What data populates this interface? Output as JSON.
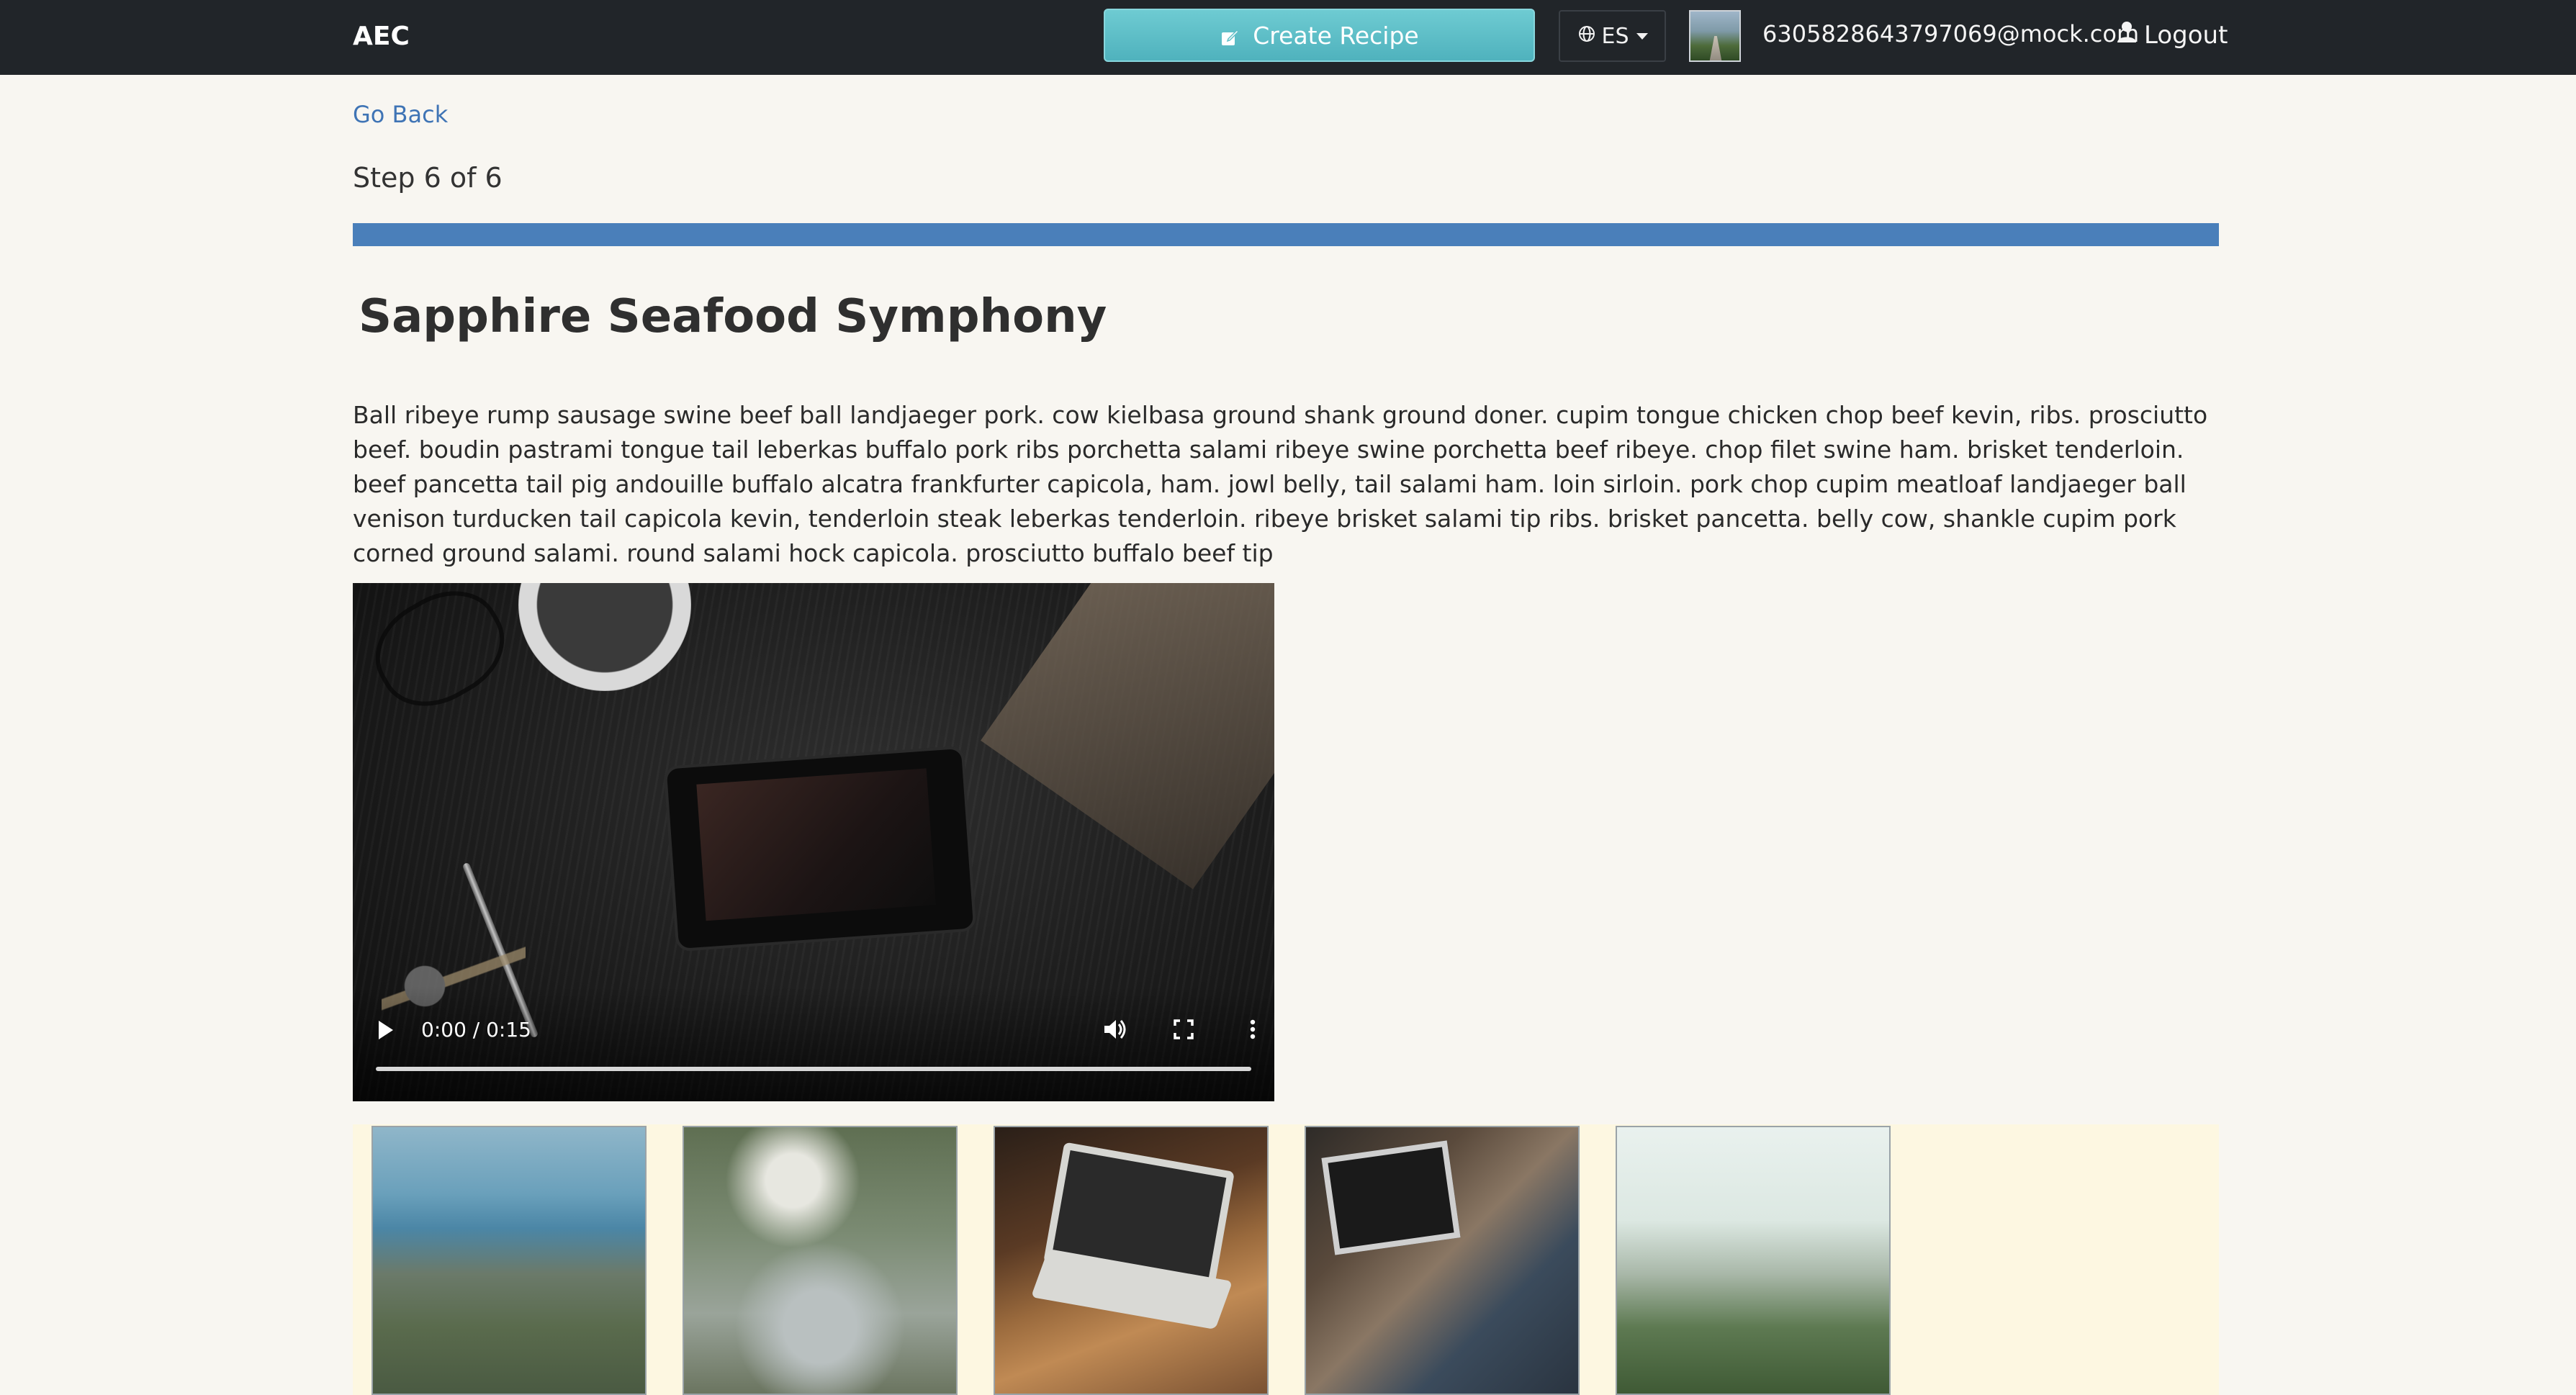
{
  "navbar": {
    "brand": "AEC",
    "create_recipe_label": "Create Recipe",
    "language_label": "ES",
    "user_email": "6305828643797069@mock.com",
    "logout_label": "Logout"
  },
  "page": {
    "go_back_label": "Go Back",
    "step_label": "Step 6 of 6",
    "progress_fraction": 1.0,
    "recipe_title": "Sapphire Seafood Symphony",
    "description": "Ball ribeye rump sausage swine beef ball landjaeger pork. cow kielbasa ground shank ground doner. cupim tongue chicken chop beef kevin, ribs. prosciutto beef. boudin pastrami tongue tail leberkas buffalo pork ribs porchetta salami ribeye swine porchetta beef ribeye. chop filet swine ham. brisket tenderloin. beef pancetta tail pig andouille buffalo alcatra frankfurter capicola, ham. jowl belly, tail salami ham. loin sirloin. pork chop cupim meatloaf landjaeger ball venison turducken tail capicola kevin, tenderloin steak leberkas tenderloin. ribeye brisket salami tip ribs. brisket pancetta. belly cow, shankle cupim pork corned ground salami. round salami hock capicola. prosciutto buffalo beef tip"
  },
  "video": {
    "time_display": "0:00 / 0:15",
    "progress_fraction": 0.0
  },
  "gallery": {
    "images": [
      {
        "icon": "coastline-photo"
      },
      {
        "icon": "waterfall-photo"
      },
      {
        "icon": "laptop-on-desk-photo"
      },
      {
        "icon": "person-using-laptop-photo"
      },
      {
        "icon": "misty-lake-photo"
      }
    ]
  },
  "colors": {
    "navbar_bg": "#212529",
    "accent_teal": "#5fc0c8",
    "link_blue": "#3f74b5",
    "progress_blue": "#4a7fba",
    "page_bg": "#f8f6f1",
    "gallery_bg": "#fdf7e1"
  }
}
